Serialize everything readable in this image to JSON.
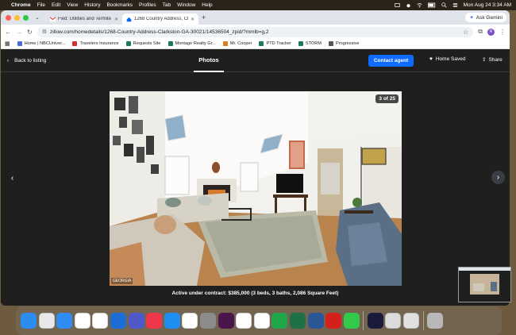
{
  "menubar": {
    "app": "Chrome",
    "items": [
      "File",
      "Edit",
      "View",
      "History",
      "Bookmarks",
      "Profiles",
      "Tab",
      "Window",
      "Help"
    ],
    "datetime": "Mon Aug 24  3:34 AM"
  },
  "tabs": [
    {
      "title": "Fwd: Utilities and Termite Re...",
      "icon": "gmail-icon",
      "active": false
    },
    {
      "title": "1268 Country Address, Clark...",
      "icon": "zillow-icon",
      "active": true
    }
  ],
  "ask_gemini": "Ask Gemini",
  "url": "zillow.com/homedetails/1268-Country-Address-Clarkston-GA-30021/14536504_zpid/?mmlb=g,2",
  "profile_initial": "R",
  "bookmarks": [
    {
      "label": "Home | NBCUniver...",
      "color": "#4a6cd4"
    },
    {
      "label": "Travelers Insurance",
      "color": "#d32f2f"
    },
    {
      "label": "Requests Site",
      "color": "#1c7a5a"
    },
    {
      "label": "Montage Realty Gr...",
      "color": "#1c7a5a"
    },
    {
      "label": "Mr. Cooper",
      "color": "#e07a1f"
    },
    {
      "label": "PTD Tracker",
      "color": "#1c7a5a"
    },
    {
      "label": "STORM",
      "color": "#1c7a5a"
    },
    {
      "label": "Progressive",
      "color": "#555555"
    }
  ],
  "viewer": {
    "back_label": "Back to listing",
    "photos_label": "Photos",
    "contact_label": "Contact agent",
    "saved_label": "Home Saved",
    "share_label": "Share",
    "counter": "3 of 25",
    "mls_tag": "GEORGIA",
    "caption": "Active under contract: $385,000 (3 beds, 3 baths, 2,086 Square Feet)",
    "accent": "#0d6bff"
  },
  "dock": [
    {
      "name": "finder-icon",
      "color": "#2d8cf0"
    },
    {
      "name": "launchpad-icon",
      "color": "#e8e8ea"
    },
    {
      "name": "safari-icon",
      "color": "#2f8cf3"
    },
    {
      "name": "chrome-icon",
      "color": "#ffffff"
    },
    {
      "name": "reminders-icon",
      "color": "#ffffff"
    },
    {
      "name": "outlook-icon",
      "color": "#1c6ed6"
    },
    {
      "name": "teams-icon",
      "color": "#5059c9"
    },
    {
      "name": "news-icon",
      "color": "#f0364a"
    },
    {
      "name": "appstore-icon",
      "color": "#1e8ef3"
    },
    {
      "name": "calendar-icon",
      "color": "#ffffff"
    },
    {
      "name": "settings-icon",
      "color": "#8c8c8c"
    },
    {
      "name": "slack-icon",
      "color": "#4a154b"
    },
    {
      "name": "photos-icon",
      "color": "#ffffff"
    },
    {
      "name": "notes-icon",
      "color": "#ffffff"
    },
    {
      "name": "numbers-icon",
      "color": "#1fa74a"
    },
    {
      "name": "excel-icon",
      "color": "#1e7145"
    },
    {
      "name": "word-icon",
      "color": "#2b5797"
    },
    {
      "name": "acrobat-icon",
      "color": "#d4201b"
    },
    {
      "name": "messages-icon",
      "color": "#33c94a"
    },
    {
      "name": "screenshot-icon",
      "color": "#1a1a3a"
    },
    {
      "name": "preview-icon",
      "color": "#dcdcdc"
    },
    {
      "name": "finder-window-icon",
      "color": "#e0e0e0"
    },
    {
      "name": "trash-icon",
      "color": "#b8b8b8"
    }
  ]
}
